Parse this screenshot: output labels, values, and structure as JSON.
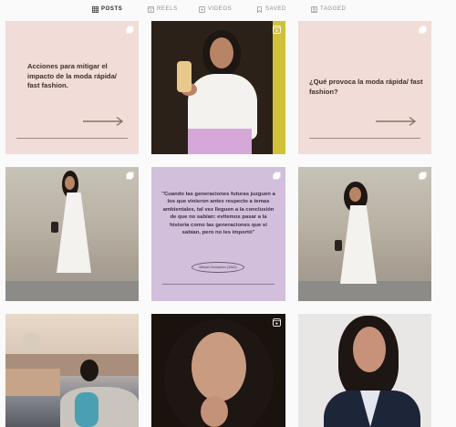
{
  "tabs": [
    {
      "label": "POSTS",
      "icon": "grid-icon",
      "active": true
    },
    {
      "label": "REELS",
      "icon": "reels-icon",
      "active": false
    },
    {
      "label": "VIDEOS",
      "icon": "video-icon",
      "active": false
    },
    {
      "label": "SAVED",
      "icon": "bookmark-icon",
      "active": false
    },
    {
      "label": "TAGGED",
      "icon": "tagged-icon",
      "active": false
    }
  ],
  "posts": [
    {
      "kind": "text",
      "caption": "Acciones para mitigar el impacto de la moda rápida/ fast fashion.",
      "badge": "carousel-icon"
    },
    {
      "kind": "photo",
      "subject": "woman in white blouse holding drink",
      "badge": "reel-icon"
    },
    {
      "kind": "text",
      "caption": "¿Qué provoca la moda rápida/ fast fashion?",
      "badge": "carousel-icon"
    },
    {
      "kind": "photo",
      "subject": "woman in white dress by stone wall",
      "badge": "carousel-icon"
    },
    {
      "kind": "quote",
      "quote": "\"Cuando las generaciones futuras juzguen a los que vinieron antes respecto a temas ambientales, tal vez lleguen a la conclusión de que no sabían: evitemos pasar a la historia como las generaciones que sí sabían, pero no les importó\"",
      "author": "Mikhail Gorbachev (2002)",
      "badge": "carousel-icon"
    },
    {
      "kind": "photo",
      "subject": "woman in white dress by stone wall",
      "badge": "carousel-icon"
    },
    {
      "kind": "photo",
      "subject": "woman on rooftop terrace",
      "badge": ""
    },
    {
      "kind": "photo",
      "subject": "curly haired woman portrait",
      "badge": "reel-icon"
    },
    {
      "kind": "photo",
      "subject": "woman in navy blazer portrait",
      "badge": ""
    }
  ],
  "colors": {
    "accent_pink": "#f1dcd8",
    "accent_lilac": "#d2bfdb",
    "tab_active": "#262626",
    "tab_inactive": "#8e8e8e"
  }
}
